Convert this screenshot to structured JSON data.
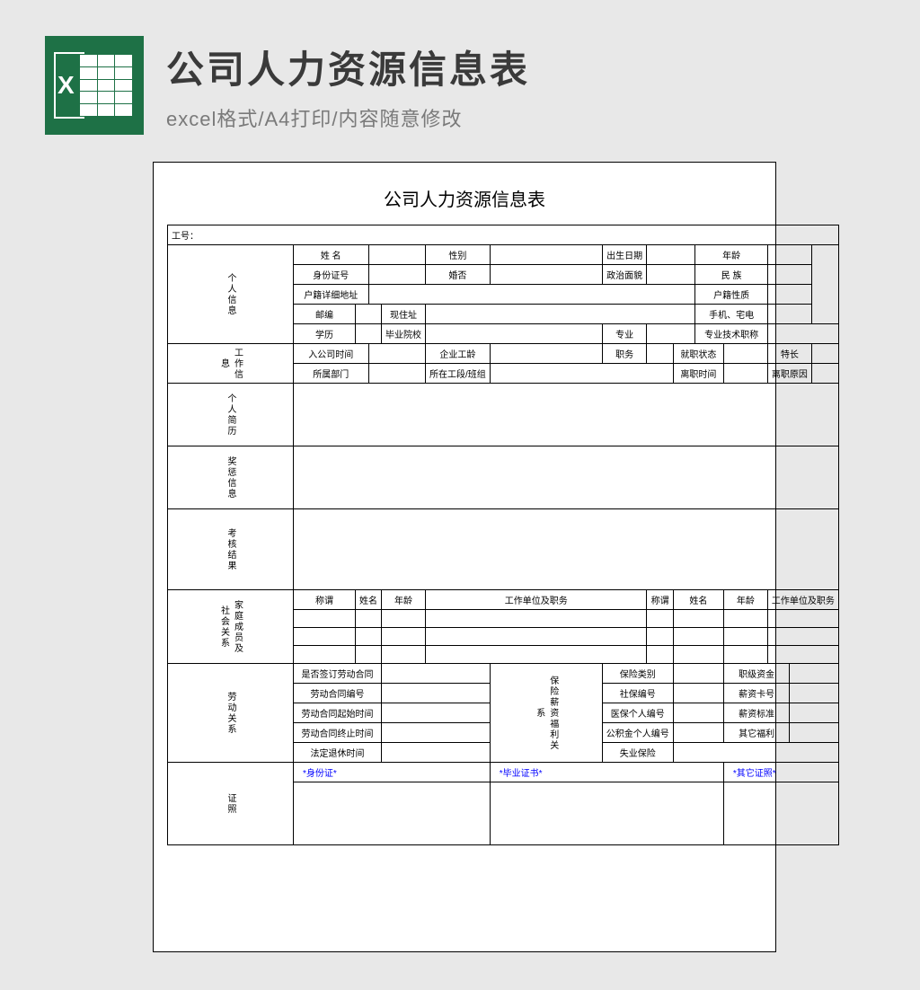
{
  "header": {
    "title": "公司人力资源信息表",
    "subtitle": "excel格式/A4打印/内容随意修改"
  },
  "form": {
    "title": "公司人力资源信息表",
    "emp_id": "工号：",
    "sections": {
      "personal": "个人信息",
      "work": "工作信息",
      "resume": "个人简历",
      "award": "奖惩信息",
      "review": "考核结果",
      "family": "家庭成员及社会关系",
      "labor": "劳动关系",
      "insurance": "保险薪资福利关系",
      "cert": "证照"
    },
    "fields": {
      "name": "姓 名",
      "gender": "性别",
      "birth": "出生日期",
      "age": "年龄",
      "idcard": "身份证号",
      "marital": "婚否",
      "political": "政治面貌",
      "ethnicity": "民 族",
      "hukou_addr": "户籍详细地址",
      "hukou_type": "户籍性质",
      "postcode": "邮编",
      "address": "现住址",
      "mobile": "手机、宅电",
      "education": "学历",
      "school": "毕业院校",
      "major": "专业",
      "tech_title": "专业技术职称",
      "join_date": "入公司时间",
      "company_age": "企业工龄",
      "position": "职务",
      "status": "就职状态",
      "specialty": "特长",
      "dept": "所属部门",
      "workgroup": "所在工段/班组",
      "leave_date": "离职时间",
      "leave_reason": "离职原因",
      "relation": "称谓",
      "fam_name": "姓名",
      "fam_age": "年龄",
      "fam_work": "工作单位及职务",
      "contract_signed": "是否签订劳动合同",
      "contract_no": "劳动合同编号",
      "contract_start": "劳动合同起始时间",
      "contract_end": "劳动合同终止时间",
      "retire_date": "法定退休时间",
      "ins_type": "保险类别",
      "soc_ins_no": "社保编号",
      "med_ins_no": "医保个人编号",
      "fund_no": "公积金个人编号",
      "unemp_ins": "失业保险",
      "base_salary": "职级资金",
      "salary_card": "薪资卡号",
      "salary_standard": "薪资标准",
      "other_benefit": "其它福利",
      "doc_id": "*身份证*",
      "doc_edu": "*毕业证书*",
      "doc_cert": "*其它证照*"
    }
  }
}
